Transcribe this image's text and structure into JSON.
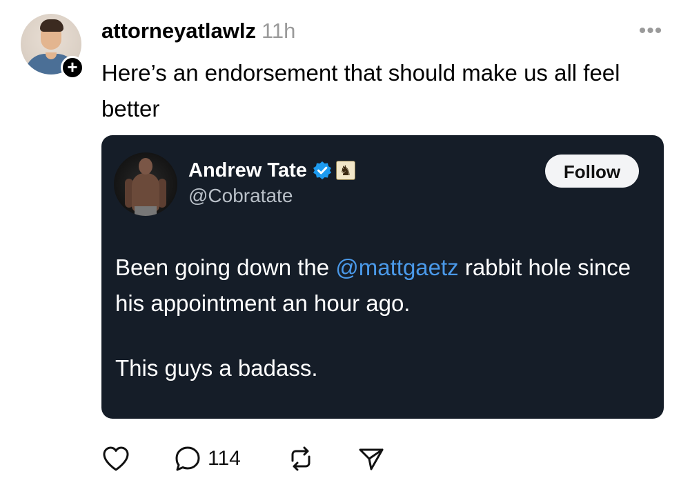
{
  "post": {
    "username": "attorneyatlawlz",
    "time": "11h",
    "text": "Here’s an endorsement that should make us all feel better",
    "more_label": "•••"
  },
  "embed": {
    "name": "Andrew Tate",
    "handle": "@Cobratate",
    "follow_label": "Follow",
    "text_before": "Been going down the ",
    "mention": "@mattgaetz",
    "text_after": " rabbit hole since his appointment an hour ago.",
    "text_second": "This guys a badass."
  },
  "actions": {
    "reply_count": "114"
  },
  "colors": {
    "embed_bg": "#151d28",
    "mention": "#4a99e9",
    "verified": "#1d9bf0",
    "muted": "#9a9a9a"
  },
  "icons": [
    "plus-icon",
    "more-icon",
    "verified-icon",
    "affiliation-icon",
    "heart-icon",
    "comment-icon",
    "repost-icon",
    "share-icon"
  ]
}
